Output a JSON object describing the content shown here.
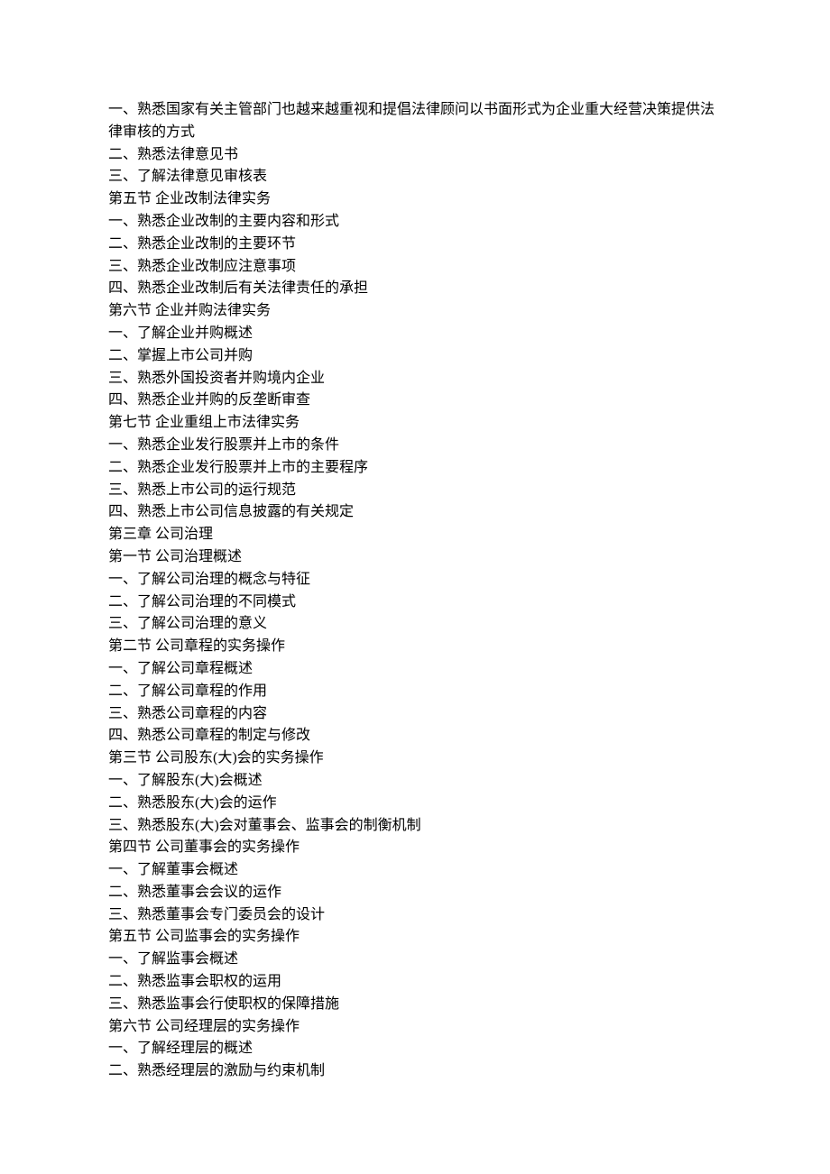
{
  "lines": [
    "一、熟悉国家有关主管部门也越来越重视和提倡法律顾问以书面形式为企业重大经营决策提供法律审核的方式",
    "二、熟悉法律意见书",
    "三、了解法律意见审核表",
    "第五节  企业改制法律实务",
    "一、熟悉企业改制的主要内容和形式",
    "二、熟悉企业改制的主要环节",
    "三、熟悉企业改制应注意事项",
    "四、熟悉企业改制后有关法律责任的承担",
    "第六节  企业并购法律实务",
    "一、了解企业并购概述",
    "二、掌握上市公司并购",
    "三、熟悉外国投资者并购境内企业",
    "四、熟悉企业并购的反垄断审查",
    "第七节  企业重组上市法律实务",
    "一、熟悉企业发行股票并上市的条件",
    "二、熟悉企业发行股票并上市的主要程序",
    "三、熟悉上市公司的运行规范",
    "四、熟悉上市公司信息披露的有关规定",
    "第三章  公司治理",
    "第一节  公司治理概述",
    "一、了解公司治理的概念与特征",
    "二、了解公司治理的不同模式",
    "三、了解公司治理的意义",
    "第二节  公司章程的实务操作",
    "一、了解公司章程概述",
    "二、了解公司章程的作用",
    "三、熟悉公司章程的内容",
    "四、熟悉公司章程的制定与修改",
    "第三节  公司股东(大)会的实务操作",
    "一、了解股东(大)会概述",
    "二、熟悉股东(大)会的运作",
    "三、熟悉股东(大)会对董事会、监事会的制衡机制",
    "第四节  公司董事会的实务操作",
    "一、了解董事会概述",
    "二、熟悉董事会会议的运作",
    "三、熟悉董事会专门委员会的设计",
    "第五节  公司监事会的实务操作",
    "一、了解监事会概述",
    "二、熟悉监事会职权的运用",
    "三、熟悉监事会行使职权的保障措施",
    "第六节  公司经理层的实务操作",
    "一、了解经理层的概述",
    "二、熟悉经理层的激励与约束机制"
  ]
}
